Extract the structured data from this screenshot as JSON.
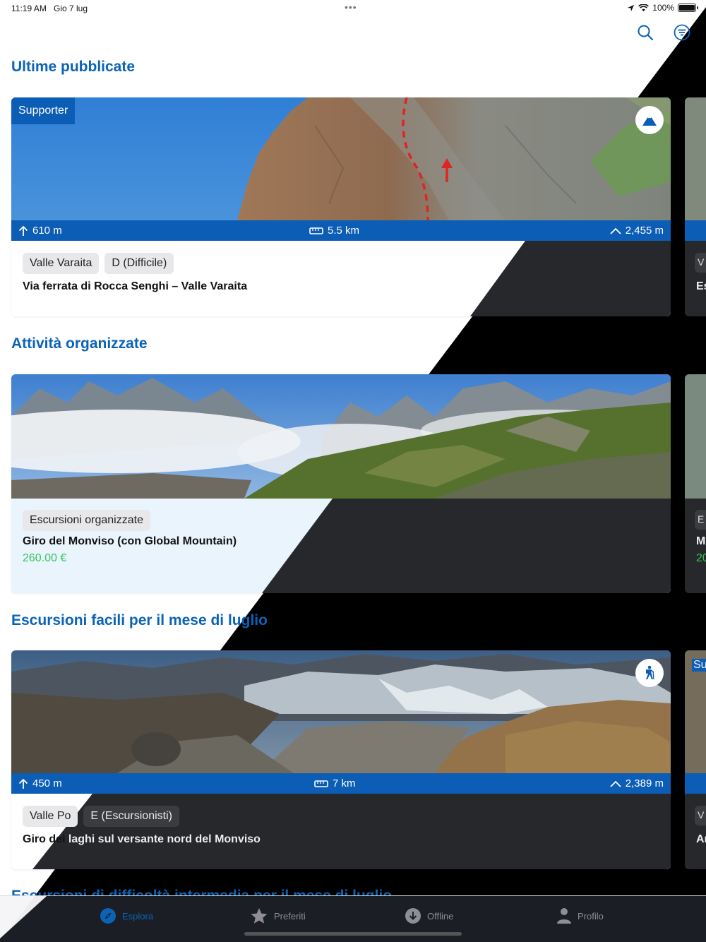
{
  "status_bar": {
    "time": "11:19 AM",
    "date": "Gio 7 lug",
    "battery": "100%"
  },
  "sections": [
    {
      "title": "Ultime pubblicate",
      "card": {
        "badge": "Supporter",
        "ascent": "610 m",
        "distance": "5.5 km",
        "max_altitude": "2,455 m",
        "tags": [
          "Valle Varaita",
          "D (Difficile)"
        ],
        "title": "Via ferrata di Rocca Senghi – Valle Varaita",
        "type_icon": "mountain-icon"
      }
    },
    {
      "title": "Attività organizzate",
      "card": {
        "tags": [
          "Escursioni organizzate"
        ],
        "title": "Giro del Monviso (con Global Mountain)",
        "price": "260.00 €"
      }
    },
    {
      "title": "Escursioni facili per il mese di luglio",
      "card": {
        "ascent": "450 m",
        "distance": "7 km",
        "max_altitude": "2,389 m",
        "tags": [
          "Valle Po",
          "E (Escursionisti)"
        ],
        "title": "Giro dei laghi sul versante nord del Monviso",
        "type_icon": "hiker-icon"
      }
    },
    {
      "title": "Escursioni di difficoltà intermedia per il mese di luglio"
    }
  ],
  "side_cards": {
    "card1_title_fragment": "Es",
    "card2_title_fragment": "M",
    "card2_price_fragment": "20",
    "card3_badge_fragment": "Su",
    "card3_title_fragment": "Ar"
  },
  "tabs": [
    {
      "label": "Esplora",
      "icon": "compass-icon",
      "active": true
    },
    {
      "label": "Preferiti",
      "icon": "star-icon",
      "active": false
    },
    {
      "label": "Offline",
      "icon": "download-icon",
      "active": false
    },
    {
      "label": "Profilo",
      "icon": "person-icon",
      "active": false
    }
  ],
  "colors": {
    "accent": "#0b63b6",
    "stats_bar": "#0b5db5",
    "price": "#34c759"
  }
}
